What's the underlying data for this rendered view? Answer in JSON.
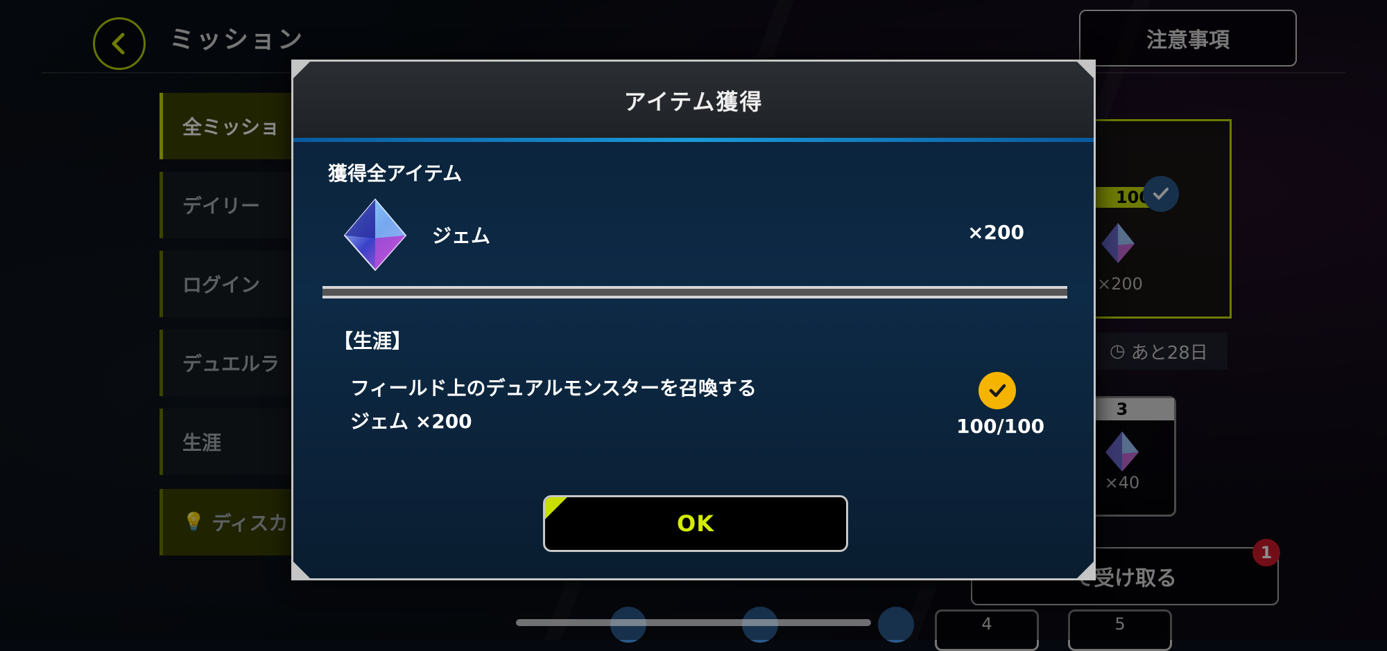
{
  "header": {
    "title": "ミッション",
    "notes_button": "注意事項"
  },
  "sidebar": {
    "items": [
      {
        "label": "全ミッショ"
      },
      {
        "label": "デイリー"
      },
      {
        "label": "ログイン"
      },
      {
        "label": "デュエルラ"
      },
      {
        "label": "生涯"
      },
      {
        "label": "ディスカ"
      }
    ]
  },
  "right_panel": {
    "badge": "100",
    "reward_qty": "×200",
    "days_left": "あと28日",
    "slot_number": "3",
    "slot_qty": "×40",
    "claim_button": "て受け取る",
    "claim_count": "1",
    "bottom_slots": [
      "4",
      "5"
    ]
  },
  "modal": {
    "title": "アイテム獲得",
    "section_label": "獲得全アイテム",
    "item": {
      "name": "ジェム",
      "quantity": "×200",
      "icon": "gem-icon"
    },
    "mission": {
      "tag": "【生涯】",
      "description": "フィールド上のデュアルモンスターを召喚する",
      "reward": "ジェム ×200",
      "progress": "100/100",
      "status_icon": "check-icon"
    },
    "ok_button": "OK"
  },
  "colors": {
    "accent_yellow": "#c8e000",
    "check_orange": "#f4b400",
    "modal_blue": "#0d2a46"
  }
}
